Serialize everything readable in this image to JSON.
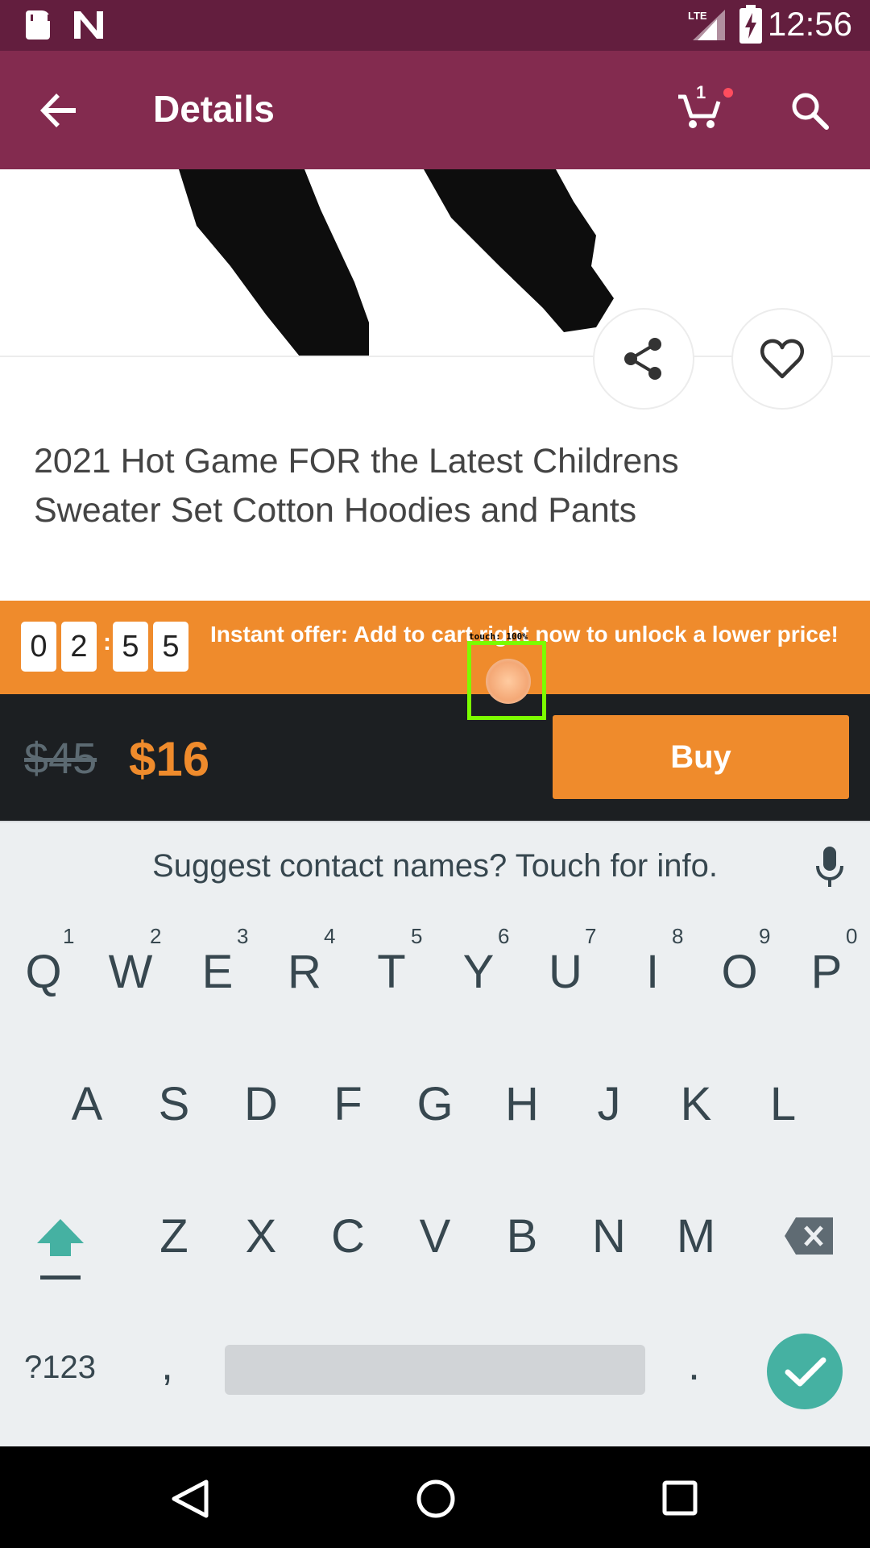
{
  "status_bar": {
    "time": "12:56",
    "network": "LTE"
  },
  "app_bar": {
    "title": "Details",
    "cart_count": "1"
  },
  "product": {
    "title": "2021 Hot Game FOR the Latest Childrens Sweater Set Cotton Hoodies and Pants"
  },
  "offer": {
    "timer_digits": [
      "0",
      "2",
      "5",
      "5"
    ],
    "timer_separator": ":",
    "text": "Instant offer: Add to cart right now to unlock a lower price!"
  },
  "price": {
    "old": "$45",
    "new": "$16",
    "buy_label": "Buy"
  },
  "touch": {
    "label": "touch: 100%"
  },
  "keyboard": {
    "suggestion": "Suggest contact names? Touch for info.",
    "row1": [
      "Q",
      "W",
      "E",
      "R",
      "T",
      "Y",
      "U",
      "I",
      "O",
      "P"
    ],
    "row1_hints": [
      "1",
      "2",
      "3",
      "4",
      "5",
      "6",
      "7",
      "8",
      "9",
      "0"
    ],
    "row2": [
      "A",
      "S",
      "D",
      "F",
      "G",
      "H",
      "J",
      "K",
      "L"
    ],
    "row3": [
      "Z",
      "X",
      "C",
      "V",
      "B",
      "N",
      "M"
    ],
    "symbols_key": "?123",
    "comma_key": ",",
    "period_key": "."
  },
  "colors": {
    "status_bar": "#631e3e",
    "app_bar": "#832b4f",
    "accent_orange": "#ef8b2c",
    "price_bar": "#1c1f22",
    "keyboard_accent": "#45b1a2"
  }
}
